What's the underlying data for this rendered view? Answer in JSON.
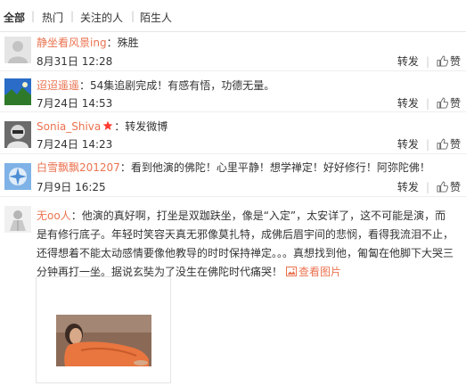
{
  "filter": {
    "all": "全部",
    "separator": "|",
    "tabs": [
      "热门",
      "关注的人",
      "陌生人"
    ]
  },
  "comments": [
    {
      "user": "静坐看风景ing",
      "text": "：殊胜",
      "time": "8月31日 12:28"
    },
    {
      "user": "迢迢遥遥",
      "text": "：54集追剧完成！有感有悟，功德无量。",
      "time": "7月24日 14:53"
    },
    {
      "user": "Sonia_Shiva",
      "text": "：转发微博",
      "time": "7月24日 14:23"
    },
    {
      "user": "白雪飘飘201207",
      "text": "：看到他演的佛陀！心里平静！想学禅定！好好修行！阿弥陀佛！",
      "time": "7月9日 16:25"
    },
    {
      "user": "无oo人",
      "text": "：他演的真好啊，打坐是双跏趺坐，像是“入定”，太安详了，这不可能是演，而是有修行底子。年轻时笑容天真无邪像莫扎特，成佛后眉宇间的悲悯，看得我流泪不止，还得想着不能太动感情要像他教导的时时保持禅定。。。真想找到他，匍匐在他脚下大哭三分钟再打一坐。据说玄奘为了没生在佛陀时代痛哭！",
      "view_pic": "查看图片"
    }
  ],
  "actions": {
    "repost": "转发",
    "like": "赞",
    "separator": "|"
  },
  "colors": {
    "username": "#eb7350",
    "divider": "#eeeeee",
    "star": "#ff3b30"
  },
  "icons": {
    "like": "thumbs-up-icon",
    "picture": "picture-icon",
    "star": "star-icon"
  }
}
